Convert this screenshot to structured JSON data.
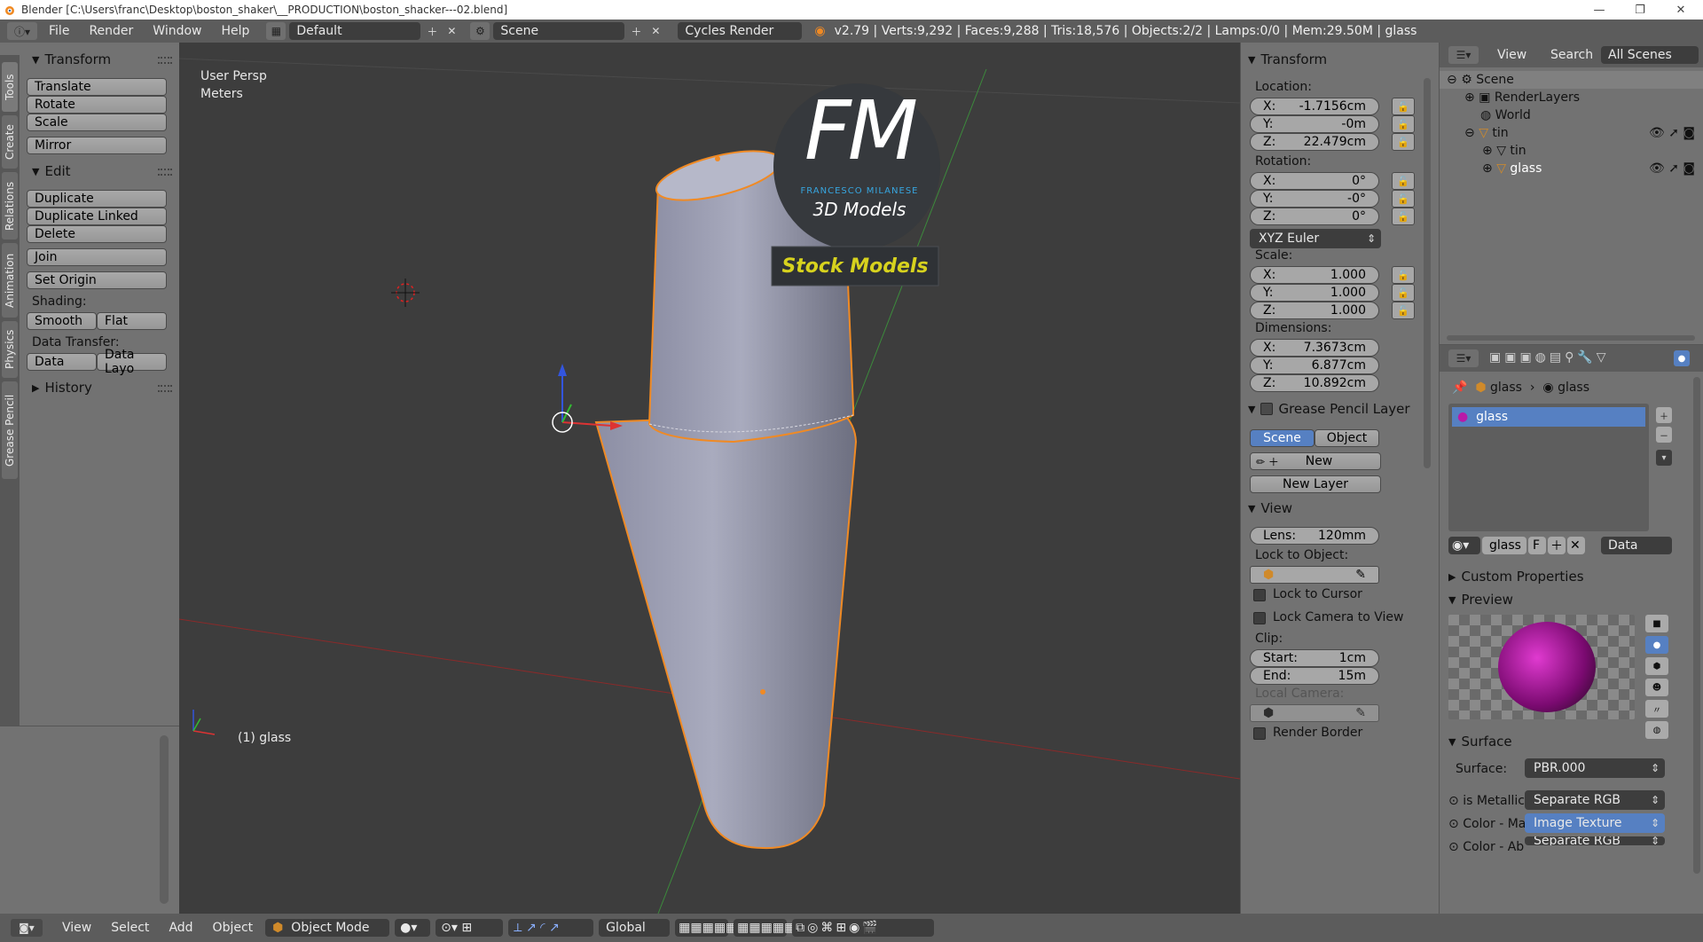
{
  "window": {
    "title": "Blender [C:\\Users\\franc\\Desktop\\boston_shaker\\__PRODUCTION\\boston_shacker---02.blend]"
  },
  "topbar": {
    "menus": [
      "File",
      "Render",
      "Window",
      "Help"
    ],
    "layout": "Default",
    "scene": "Scene",
    "engine": "Cycles Render",
    "info": "v2.79 | Verts:9,292 | Faces:9,288 | Tris:18,576 | Objects:2/2 | Lamps:0/0 | Mem:29.50M | glass"
  },
  "tool_tabs": [
    "Tools",
    "Create",
    "Relations",
    "Animation",
    "Physics",
    "Grease Pencil"
  ],
  "toolshelf": {
    "transform_title": "Transform",
    "translate": "Translate",
    "rotate": "Rotate",
    "scale": "Scale",
    "mirror": "Mirror",
    "edit_title": "Edit",
    "duplicate": "Duplicate",
    "duplicate_linked": "Duplicate Linked",
    "delete": "Delete",
    "join": "Join",
    "set_origin": "Set Origin",
    "shading_label": "Shading:",
    "smooth": "Smooth",
    "flat": "Flat",
    "data_transfer_label": "Data Transfer:",
    "data": "Data",
    "data_layout": "Data Layo",
    "history_title": "History"
  },
  "viewport": {
    "view_name": "User Persp",
    "units": "Meters",
    "object_label": "(1) glass",
    "logo": {
      "letters": "FM",
      "author": "FRANCESCO MILANESE",
      "subtitle": "3D Models",
      "banner": "Stock Models"
    }
  },
  "npanel": {
    "transform_title": "Transform",
    "location_label": "Location:",
    "location": [
      {
        "k": "X:",
        "v": "-1.7156cm"
      },
      {
        "k": "Y:",
        "v": "-0m"
      },
      {
        "k": "Z:",
        "v": "22.479cm"
      }
    ],
    "rotation_label": "Rotation:",
    "rotation": [
      {
        "k": "X:",
        "v": "0°"
      },
      {
        "k": "Y:",
        "v": "-0°"
      },
      {
        "k": "Z:",
        "v": "0°"
      }
    ],
    "rotation_mode": "XYZ Euler",
    "scale_label": "Scale:",
    "scale": [
      {
        "k": "X:",
        "v": "1.000"
      },
      {
        "k": "Y:",
        "v": "1.000"
      },
      {
        "k": "Z:",
        "v": "1.000"
      }
    ],
    "dimensions_label": "Dimensions:",
    "dimensions": [
      {
        "k": "X:",
        "v": "7.3673cm"
      },
      {
        "k": "Y:",
        "v": "6.877cm"
      },
      {
        "k": "Z:",
        "v": "10.892cm"
      }
    ],
    "grease_title": "Grease Pencil Layer",
    "grease_scene": "Scene",
    "grease_object": "Object",
    "new": "New",
    "new_layer": "New Layer",
    "view_title": "View",
    "lens_label": "Lens:",
    "lens_value": "120mm",
    "lock_to_object": "Lock to Object:",
    "lock_to_cursor": "Lock to Cursor",
    "lock_camera": "Lock Camera to View",
    "clip_label": "Clip:",
    "clip_start_label": "Start:",
    "clip_start": "1cm",
    "clip_end_label": "End:",
    "clip_end": "15m",
    "local_camera": "Local Camera:",
    "render_border": "Render Border"
  },
  "outliner": {
    "view": "View",
    "search": "Search",
    "filter": "All Scenes",
    "items": [
      "Scene",
      "RenderLayers",
      "World",
      "tin",
      "tin",
      "glass"
    ]
  },
  "properties": {
    "breadcrumb_obj": "glass",
    "breadcrumb_mat": "glass",
    "slot": "glass",
    "material_name": "glass",
    "material_f": "F",
    "link": "Data",
    "custom_props": "Custom Properties",
    "preview": "Preview",
    "surface_title": "Surface",
    "surface_label": "Surface:",
    "surface_value": "PBR.000",
    "is_metallic_label": "is Metallic",
    "is_metallic_value": "Separate RGB",
    "color_ma_label": "Color - Ma",
    "color_ma_value": "Image Texture",
    "color_ab_label": "Color - Ab",
    "color_ab_value": "Separate RGB"
  },
  "bottombar": {
    "view": "View",
    "select": "Select",
    "add": "Add",
    "object": "Object",
    "mode": "Object Mode",
    "orientation": "Global"
  },
  "colors": {
    "viewport_bg": "#3d3d3d",
    "panel_bg": "#727272",
    "header_bg": "#5c5c5c",
    "selection_blue": "#5680c2",
    "object_outline": "#f08a24",
    "logo_text": "#ffffff",
    "logo_accent": "#37a6e0",
    "logo_banner_text": "#d7d21e"
  }
}
